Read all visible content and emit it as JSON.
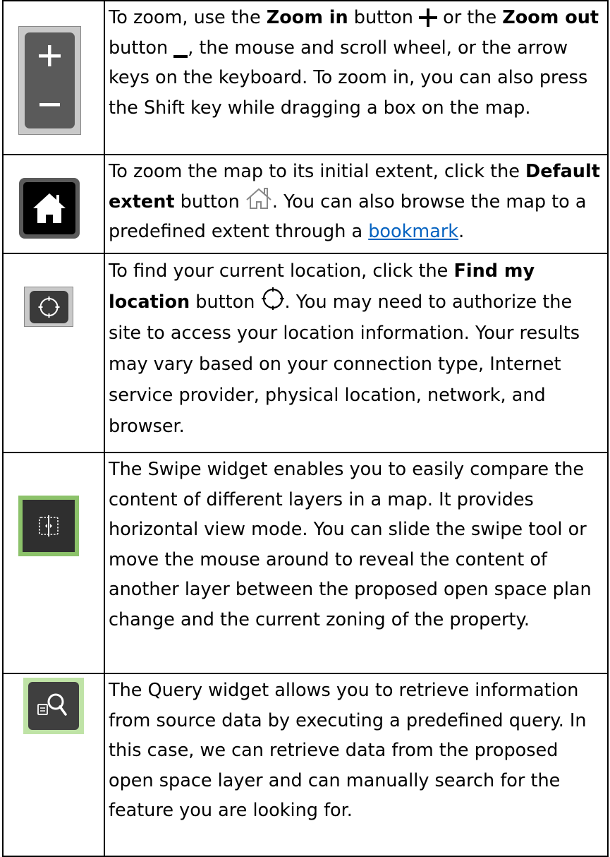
{
  "rows": [
    {
      "text": {
        "a": "To zoom, use the ",
        "b1": "Zoom in",
        "c": " button ",
        "d": " or the ",
        "b2": "Zoom out",
        "e": " button ",
        "f": ", the mouse and scroll wheel, or the arrow keys on the keyboard. To zoom in, you can also press the Shift key while dragging a box on the map."
      }
    },
    {
      "text": {
        "a": "To zoom the map to its initial extent, click the ",
        "b1": "Default extent",
        "c": " button ",
        "d": ". You can also browse the map to a predefined extent through a ",
        "link": "bookmark",
        "e": "."
      }
    },
    {
      "text": {
        "a": "To find your current location, click the ",
        "b1": "Find my location",
        "c": " button ",
        "d": ". You may need to authorize the site to access your location information. Your results may vary based on your connection type, Internet service provider, physical location, network, and browser."
      }
    },
    {
      "text": "The Swipe widget enables you to easily compare the content of different layers in a map. It provides horizontal view mode. You can slide the swipe tool or move the mouse around to reveal the content of another layer between the proposed open space plan change and the current zoning of the property."
    },
    {
      "text": "The Query widget allows you to retrieve information from source data by executing a predefined query. In this case, we can retrieve data from the proposed open space layer and can manually search for the feature you are looking for."
    }
  ],
  "colors": {
    "widget_dark": "#3a3a3a",
    "green_frame": "#8cc26a",
    "link": "#0563c1"
  }
}
